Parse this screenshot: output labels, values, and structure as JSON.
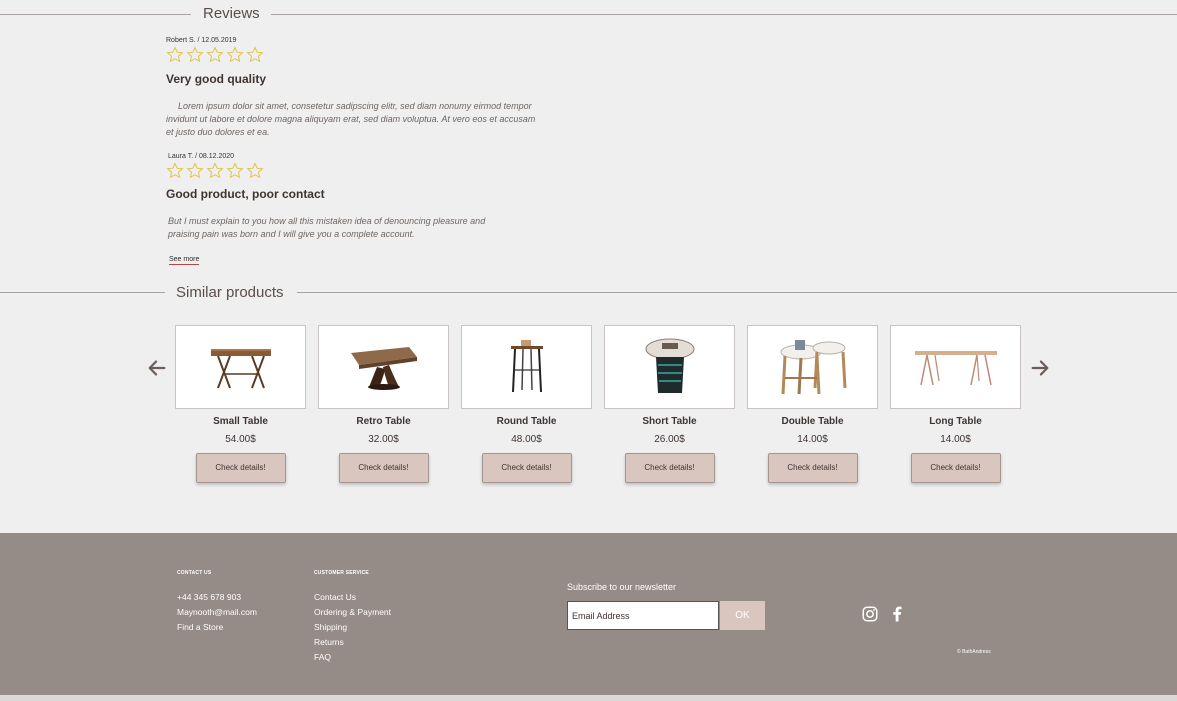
{
  "reviews": {
    "title": "Reviews",
    "items": [
      {
        "meta": "Robert S. / 12.05.2019",
        "stars": 0,
        "title": "Very good quality",
        "body": "Lorem ipsum dolor sit amet, consetetur sadipscing elitr, sed diam nonumy eirmod tempor invidunt ut labore et dolore magna aliquyam erat, sed diam voluptua. At vero eos et accusam et justo duo dolores et ea."
      },
      {
        "meta": "Laura T. / 08.12.2020",
        "stars": 0,
        "title": "Good product, poor contact",
        "body": "But I must explain to you how all this mistaken idea of denouncing pleasure and praising pain was born and I will give you a complete account."
      }
    ],
    "see_more": "See more"
  },
  "similar": {
    "title": "Similar products",
    "button_label": "Check details!",
    "products": [
      {
        "name": "Small Table",
        "price": "54.00$",
        "icon": "small-table-image"
      },
      {
        "name": "Retro Table",
        "price": "32.00$",
        "icon": "retro-table-image"
      },
      {
        "name": "Round Table",
        "price": "48.00$",
        "icon": "round-table-image"
      },
      {
        "name": "Short Table",
        "price": "26.00$",
        "icon": "short-table-image"
      },
      {
        "name": "Double Table",
        "price": "14.00$",
        "icon": "double-table-image"
      },
      {
        "name": "Long Table",
        "price": "14.00$",
        "icon": "long-table-image"
      }
    ]
  },
  "footer": {
    "contact": {
      "heading": "CONTACT US",
      "links": [
        "+44 345 678 903",
        "Maynooth@mail.com",
        "Find a Store"
      ]
    },
    "service": {
      "heading": "CUSTOMER SERVICE",
      "links": [
        "Contact Us",
        "Ordering & Payment",
        "Shipping",
        "Returns",
        "FAQ"
      ]
    },
    "newsletter": {
      "label": "Subscribe to our newsletter",
      "placeholder": "Email Address",
      "button": "OK"
    },
    "social": [
      "instagram-icon",
      "facebook-icon"
    ],
    "copyright": "© BathAndress"
  },
  "colors": {
    "background": "#efefef",
    "footer": "#958b87",
    "button": "#d9c6bf",
    "star_outline": "#e0c24a"
  }
}
